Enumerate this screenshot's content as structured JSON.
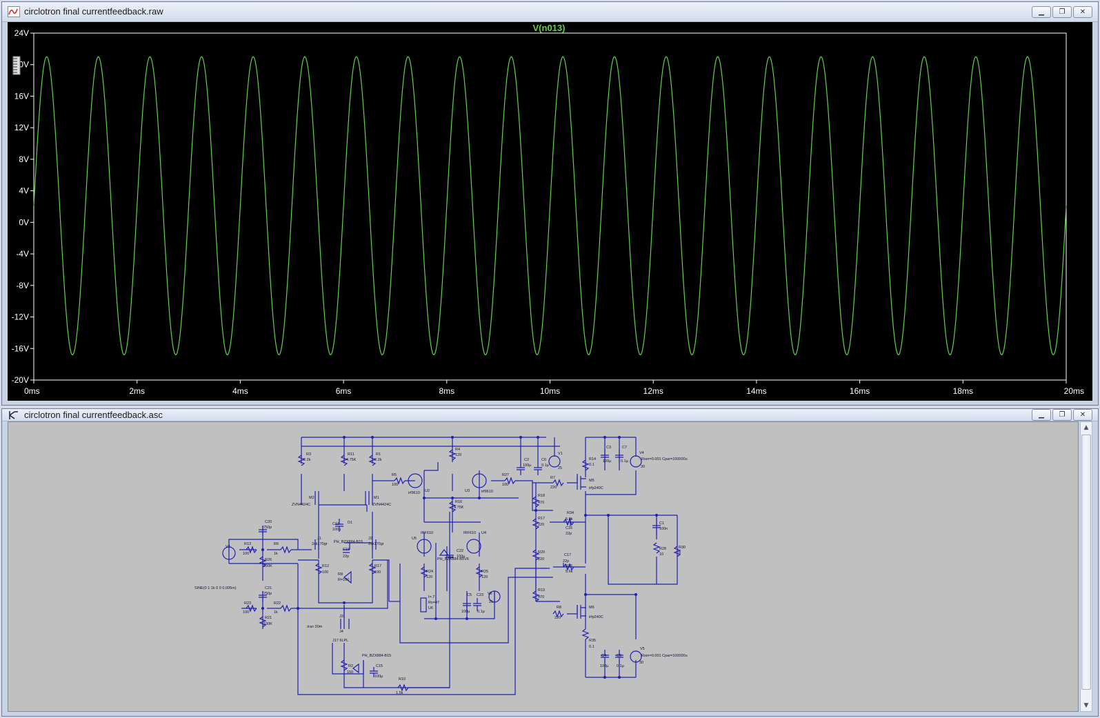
{
  "plot_window": {
    "title": "circlotron final currentfeedback.raw",
    "trace_label": "V(n013)"
  },
  "schematic_window": {
    "title": "circlotron final currentfeedback.asc",
    "labels": [
      {
        "text": "R3"
      },
      {
        "text": "2.2k"
      },
      {
        "text": "R11"
      },
      {
        "text": "4.75K"
      },
      {
        "text": "R1"
      },
      {
        "text": "2.2k"
      },
      {
        "text": "R4"
      },
      {
        "text": "120"
      },
      {
        "text": "R5"
      },
      {
        "text": "100"
      },
      {
        "text": "irf9610"
      },
      {
        "text": "U2"
      },
      {
        "text": "U3"
      },
      {
        "text": "irf9610"
      },
      {
        "text": "R27"
      },
      {
        "text": "100"
      },
      {
        "text": "C2"
      },
      {
        "text": "100µ"
      },
      {
        "text": "C6"
      },
      {
        "text": "0.1µ"
      },
      {
        "text": "V1"
      },
      {
        "text": "25"
      },
      {
        "text": "C3"
      },
      {
        "text": "100µ"
      },
      {
        "text": "C7"
      },
      {
        "text": "0.1µ"
      },
      {
        "text": "V4"
      },
      {
        "text": "Rser=0.001 Cpar=100000u"
      },
      {
        "text": "30"
      },
      {
        "text": "R14"
      },
      {
        "text": "0.1"
      },
      {
        "text": "M2"
      },
      {
        "text": "ZVN4424C"
      },
      {
        "text": "M1"
      },
      {
        "text": "ZVN4424C"
      },
      {
        "text": "R16"
      },
      {
        "text": "4.75K"
      },
      {
        "text": "C11"
      },
      {
        "text": "100µ"
      },
      {
        "text": "D1"
      },
      {
        "text": "R7"
      },
      {
        "text": "220"
      },
      {
        "text": "M5"
      },
      {
        "text": "irfp240C"
      },
      {
        "text": "R18"
      },
      {
        "text": "470"
      },
      {
        "text": "R17"
      },
      {
        "text": "220"
      },
      {
        "text": "R34"
      },
      {
        "text": "5.6k"
      },
      {
        "text": "C16"
      },
      {
        "text": "22p"
      },
      {
        "text": "C1"
      },
      {
        "text": "100n"
      },
      {
        "text": "R28"
      },
      {
        "text": "10"
      },
      {
        "text": "R30"
      },
      {
        "text": "8"
      },
      {
        "text": "C20"
      },
      {
        "text": "750p"
      },
      {
        "text": "R13"
      },
      {
        "text": "100"
      },
      {
        "text": "R6"
      },
      {
        "text": "1k"
      },
      {
        "text": "R26"
      },
      {
        "text": "100K"
      },
      {
        "text": "J1"
      },
      {
        "text": "2sk170gr"
      },
      {
        "text": "PH_BZX884-B15"
      },
      {
        "text": "J2"
      },
      {
        "text": "2sk170gr"
      },
      {
        "text": "C19"
      },
      {
        "text": "22p"
      },
      {
        "text": "V3"
      },
      {
        "text": "U5"
      },
      {
        "text": "IRF610"
      },
      {
        "text": "IRF610"
      },
      {
        "text": "U4"
      },
      {
        "text": "C22"
      },
      {
        "text": "100µ"
      },
      {
        "text": "D4"
      },
      {
        "text": "PH_BZX884-B5V6"
      },
      {
        "text": "R20"
      },
      {
        "text": "220"
      },
      {
        "text": "C17"
      },
      {
        "text": "22p"
      },
      {
        "text": "R15"
      },
      {
        "text": "5.6k"
      },
      {
        "text": "R12"
      },
      {
        "text": "100"
      },
      {
        "text": "R8"
      },
      {
        "text": "R=100"
      },
      {
        "text": "R17"
      },
      {
        "text": "100"
      },
      {
        "text": "R24"
      },
      {
        "text": "120"
      },
      {
        "text": "R25"
      },
      {
        "text": "120"
      },
      {
        "text": "SINE(0 1 1k 0 0 0.005m)"
      },
      {
        "text": "C21"
      },
      {
        "text": "750p"
      },
      {
        "text": "I=.7"
      },
      {
        "text": "Rs=47"
      },
      {
        "text": "U6"
      },
      {
        "text": "C5"
      },
      {
        "text": "100µ"
      },
      {
        "text": "C23"
      },
      {
        "text": "0.1µ"
      },
      {
        "text": "V6"
      },
      {
        "text": "25"
      },
      {
        "text": "R19"
      },
      {
        "text": "470"
      },
      {
        "text": "R23"
      },
      {
        "text": "100"
      },
      {
        "text": "R22"
      },
      {
        "text": "1k"
      },
      {
        "text": "R21"
      },
      {
        "text": "100K"
      },
      {
        "text": "J3"
      },
      {
        "text": ".tran 20m"
      },
      {
        "text": "J4"
      },
      {
        "text": "J17 6LPL"
      },
      {
        "text": "R8"
      },
      {
        "text": "220"
      },
      {
        "text": "M6"
      },
      {
        "text": "irfp240C"
      },
      {
        "text": "PH_BZX884-B15"
      },
      {
        "text": "R35"
      },
      {
        "text": "0.1"
      },
      {
        "text": "C4"
      },
      {
        "text": "100µ"
      },
      {
        "text": "C8"
      },
      {
        "text": "0.1µ"
      },
      {
        "text": "V5"
      },
      {
        "text": "Rser=0.001 Cpar=100000u"
      },
      {
        "text": "30"
      },
      {
        "text": "R2"
      },
      {
        "text": "150"
      },
      {
        "text": "C15"
      },
      {
        "text": "100µ"
      },
      {
        "text": "R10"
      },
      {
        "text": "1.5k"
      }
    ]
  },
  "chart_data": {
    "type": "line",
    "title": "V(n013)",
    "xlabel": "",
    "ylabel": "",
    "xlim": [
      0,
      20
    ],
    "ylim": [
      -20,
      24
    ],
    "x_unit": "ms",
    "y_unit": "V",
    "x_ticks": [
      "0ms",
      "2ms",
      "4ms",
      "6ms",
      "8ms",
      "10ms",
      "12ms",
      "14ms",
      "16ms",
      "18ms",
      "20ms"
    ],
    "y_ticks": [
      "24V",
      "20V",
      "16V",
      "12V",
      "8V",
      "4V",
      "0V",
      "-4V",
      "-8V",
      "-12V",
      "-16V",
      "-20V"
    ],
    "grid": false,
    "series": [
      {
        "name": "V(n013)",
        "color": "#5fd34a",
        "waveform": "sine",
        "offset_v": 2.1,
        "amplitude_v": 18.9,
        "frequency_khz": 1,
        "first_peak_ms": 0.25
      }
    ]
  },
  "colors": {
    "plot_background": "#000000",
    "axis_text": "#ffffff",
    "trace": "#5fd34a",
    "trace_label": "#5fd34a",
    "schematic_background": "#c0c0c0",
    "wire": "#1f1fb3"
  }
}
